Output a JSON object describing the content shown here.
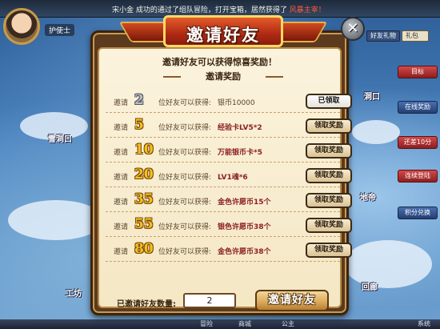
{
  "topbar": {
    "announce_prefix": "宋小金",
    "announce_text": "成功的通过了组队冒险，打开宝箱，居然获得了",
    "announce_highlight": "风暴主宰！"
  },
  "player": {
    "name": "护使士"
  },
  "map_labels": [
    "雪洞口",
    "工坊",
    "洞口",
    "回廊",
    "地帝"
  ],
  "right_panel": {
    "gift_tab": "好友礼物",
    "gift_select": "礼包",
    "buttons": [
      "目标",
      "在线奖励",
      "还差10分",
      "连续登陆",
      "积分兑换",
      "系统"
    ]
  },
  "bottom_tabs": [
    "冒险",
    "商城",
    "公主",
    "系统"
  ],
  "dialog": {
    "title": "邀请好友",
    "close_symbol": "✕",
    "subtitle": "邀请好友可以获得惊喜奖励！",
    "section_title": "邀请奖励",
    "row_prefix": "邀请",
    "row_mid": "位好友可以获得:",
    "rows": [
      {
        "count": "2",
        "reward": "银币10000",
        "button": "已领取",
        "claimed": true
      },
      {
        "count": "5",
        "reward": "经验卡LV5*2",
        "button": "领取奖励",
        "claimed": false
      },
      {
        "count": "10",
        "reward": "万能银币卡*5",
        "button": "领取奖励",
        "claimed": false
      },
      {
        "count": "20",
        "reward": "LV1魂*6",
        "button": "领取奖励",
        "claimed": false
      },
      {
        "count": "35",
        "reward": "金色许愿币15个",
        "button": "领取奖励",
        "claimed": false
      },
      {
        "count": "55",
        "reward": "银色许愿币38个",
        "button": "领取奖励",
        "claimed": false
      },
      {
        "count": "80",
        "reward": "金色许愿币38个",
        "button": "领取奖励",
        "claimed": false
      }
    ],
    "invited_label": "已邀请好友数量:",
    "invited_value": "2",
    "invite_button": "邀请好友"
  }
}
